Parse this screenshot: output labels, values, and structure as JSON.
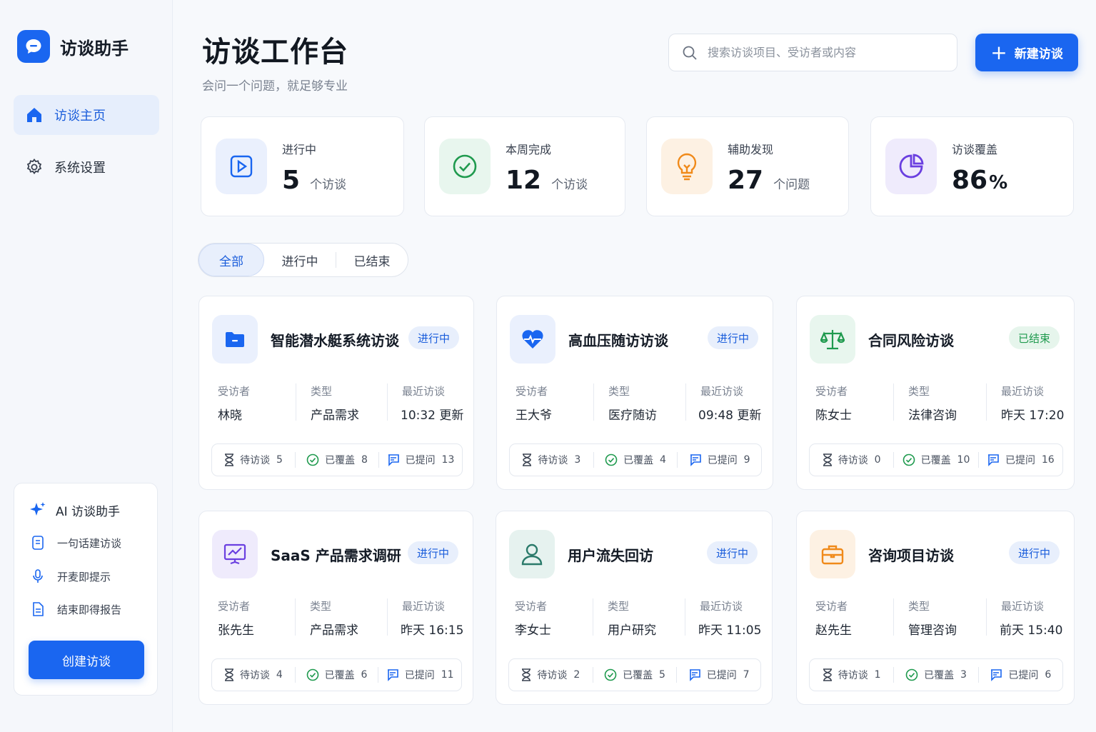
{
  "brand": {
    "name": "访谈助手"
  },
  "sidebar": {
    "items": [
      {
        "label": "访谈主页",
        "icon": "home-icon",
        "active": true
      },
      {
        "label": "系统设置",
        "icon": "gear-icon",
        "active": false
      }
    ],
    "ai": {
      "title": "AI 访谈助手",
      "features": [
        "一句话建访谈",
        "开麦即提示",
        "结束即得报告"
      ],
      "create_label": "创建访谈"
    }
  },
  "header": {
    "title": "访谈工作台",
    "subtitle": "会问一个问题，就足够专业",
    "search_placeholder": "搜索访谈项目、受访者或内容",
    "new_label": "新建访谈"
  },
  "stats": [
    {
      "label": "进行中",
      "value": "5",
      "unit": "个访谈",
      "icon": "play-icon",
      "color": "#1a66f0"
    },
    {
      "label": "本周完成",
      "value": "12",
      "unit": "个访谈",
      "icon": "check-circle-icon",
      "color": "#1f9a4e"
    },
    {
      "label": "辅助发现",
      "value": "27",
      "unit": "个问题",
      "icon": "lightbulb-icon",
      "color": "#f08a1a"
    },
    {
      "label": "访谈覆盖",
      "value": "86",
      "unit": "%",
      "icon": "pie-chart-icon",
      "color": "#6a3fe0"
    }
  ],
  "tabs": [
    "全部",
    "进行中",
    "已结束"
  ],
  "card_labels": {
    "interviewee": "受访者",
    "type": "类型",
    "recent": "最近访谈",
    "pending": "待访谈",
    "covered": "已覆盖",
    "asked": "已提问"
  },
  "cards": [
    {
      "title": "智能潜水艇系统访谈",
      "status": "进行中",
      "interviewee": "林晓",
      "type": "产品需求",
      "recent": "10:32 更新",
      "pending": "5",
      "covered": "8",
      "asked": "13",
      "icon": "folder-icon"
    },
    {
      "title": "高血压随访访谈",
      "status": "进行中",
      "interviewee": "王大爷",
      "type": "医疗随访",
      "recent": "09:48 更新",
      "pending": "3",
      "covered": "4",
      "asked": "9",
      "icon": "heart-pulse-icon"
    },
    {
      "title": "合同风险访谈",
      "status": "已结束",
      "interviewee": "陈女士",
      "type": "法律咨询",
      "recent": "昨天 17:20",
      "pending": "0",
      "covered": "10",
      "asked": "16",
      "icon": "scale-icon"
    },
    {
      "title": "SaaS 产品需求调研",
      "status": "进行中",
      "interviewee": "张先生",
      "type": "产品需求",
      "recent": "昨天 16:15",
      "pending": "4",
      "covered": "6",
      "asked": "11",
      "icon": "presentation-chart-icon"
    },
    {
      "title": "用户流失回访",
      "status": "进行中",
      "interviewee": "李女士",
      "type": "用户研究",
      "recent": "昨天 11:05",
      "pending": "2",
      "covered": "5",
      "asked": "7",
      "icon": "user-icon"
    },
    {
      "title": "咨询项目访谈",
      "status": "进行中",
      "interviewee": "赵先生",
      "type": "管理咨询",
      "recent": "前天 15:40",
      "pending": "1",
      "covered": "3",
      "asked": "6",
      "icon": "briefcase-icon"
    }
  ],
  "colors": {
    "accent": "#1a66f0",
    "done": "#1f9a4e"
  }
}
